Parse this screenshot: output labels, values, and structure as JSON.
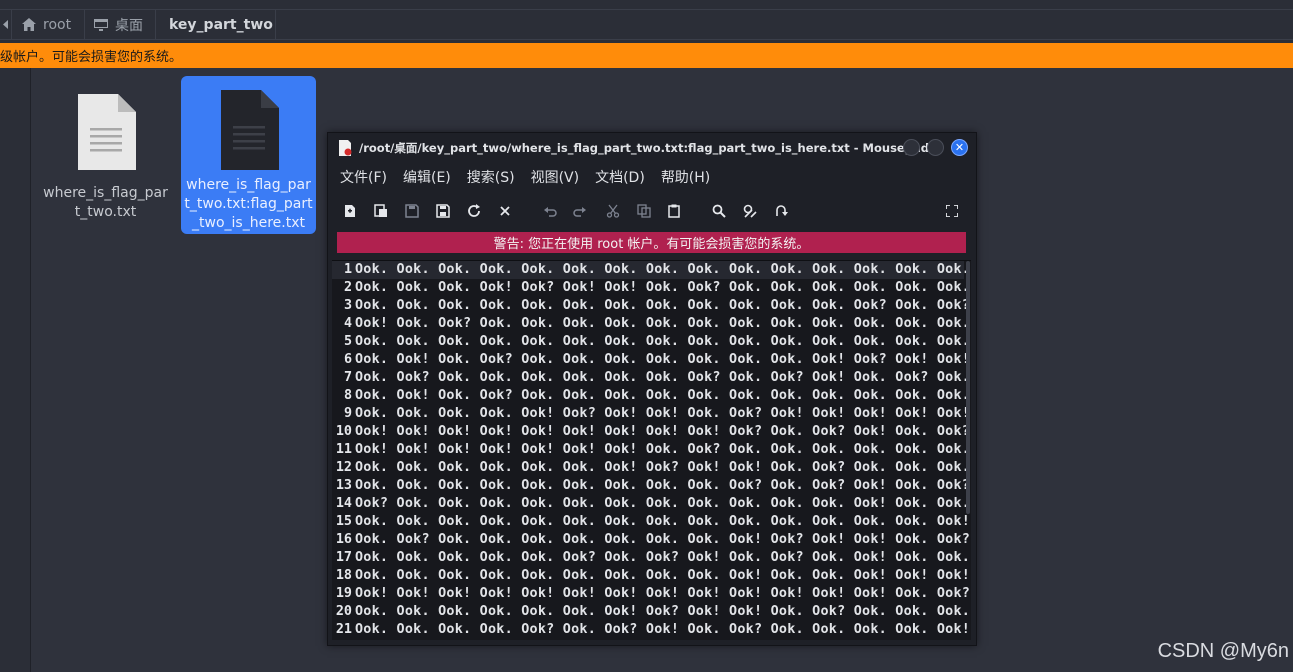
{
  "breadcrumb": {
    "items": [
      {
        "label": "root",
        "icon": "home-icon"
      },
      {
        "label": "桌面",
        "icon": "desktop-icon"
      },
      {
        "label": "key_part_two",
        "icon": ""
      }
    ]
  },
  "root_warning": "级帐户。可能会损害您的系统。",
  "files": [
    {
      "name": "where_is_flag_part_two.txt",
      "icon": "text-file-icon",
      "selected": false
    },
    {
      "name": "where_is_flag_part_two.txt:flag_part_two_is_here.txt",
      "icon": "text-file-icon",
      "selected": true
    }
  ],
  "mousepad": {
    "title": "/root/桌面/key_part_two/where_is_flag_part_two.txt:flag_part_two_is_here.txt - Mousepad",
    "menu": [
      "文件(F)",
      "编辑(E)",
      "搜索(S)",
      "视图(V)",
      "文档(D)",
      "帮助(H)"
    ],
    "warning": "警告: 您正在使用 root 帐户。有可能会损害您的系统。",
    "lines": [
      "Ook. Ook. Ook. Ook. Ook. Ook. Ook. Ook. Ook. Ook. Ook. Ook. Ook. Ook. Ook.",
      "Ook. Ook. Ook. Ook! Ook? Ook! Ook! Ook. Ook? Ook. Ook. Ook. Ook. Ook. Ook.",
      "Ook. Ook. Ook. Ook. Ook. Ook. Ook. Ook. Ook. Ook. Ook. Ook. Ook? Ook. Ook?",
      "Ook! Ook. Ook? Ook. Ook. Ook. Ook. Ook. Ook. Ook. Ook. Ook. Ook. Ook. Ook.",
      "Ook. Ook. Ook. Ook. Ook. Ook. Ook. Ook. Ook. Ook. Ook. Ook. Ook. Ook. Ook.",
      "Ook. Ook! Ook. Ook? Ook. Ook. Ook. Ook. Ook. Ook. Ook. Ook! Ook? Ook! Ook!",
      "Ook. Ook? Ook. Ook. Ook. Ook. Ook. Ook. Ook? Ook. Ook? Ook! Ook. Ook? Ook.",
      "Ook. Ook! Ook. Ook? Ook. Ook. Ook. Ook. Ook. Ook. Ook. Ook. Ook. Ook. Ook.",
      "Ook. Ook. Ook. Ook. Ook! Ook? Ook! Ook! Ook. Ook? Ook! Ook! Ook! Ook! Ook!",
      "Ook! Ook! Ook! Ook! Ook! Ook! Ook! Ook! Ook! Ook? Ook. Ook? Ook! Ook. Ook?",
      "Ook! Ook! Ook! Ook! Ook! Ook! Ook! Ook. Ook? Ook. Ook. Ook. Ook. Ook. Ook.",
      "Ook. Ook. Ook. Ook. Ook. Ook. Ook! Ook? Ook! Ook! Ook. Ook? Ook. Ook. Ook.",
      "Ook. Ook. Ook. Ook. Ook. Ook. Ook. Ook. Ook. Ook? Ook. Ook? Ook! Ook. Ook?",
      "Ook? Ook. Ook. Ook. Ook. Ook. Ook. Ook. Ook. Ook. Ook. Ook. Ook! Ook. Ook.",
      "Ook. Ook. Ook. Ook. Ook. Ook. Ook. Ook. Ook. Ook. Ook. Ook. Ook. Ook. Ook!",
      "Ook. Ook? Ook. Ook. Ook. Ook. Ook. Ook. Ook. Ook! Ook? Ook! Ook! Ook. Ook?",
      "Ook. Ook. Ook. Ook. Ook. Ook? Ook. Ook? Ook! Ook. Ook? Ook. Ook! Ook. Ook.",
      "Ook. Ook. Ook. Ook. Ook. Ook. Ook. Ook. Ook. Ook! Ook. Ook. Ook! Ook! Ook!",
      "Ook! Ook! Ook! Ook! Ook! Ook! Ook! Ook! Ook! Ook! Ook! Ook! Ook! Ook. Ook?",
      "Ook. Ook. Ook. Ook. Ook. Ook. Ook! Ook? Ook! Ook! Ook. Ook? Ook. Ook. Ook.",
      "Ook. Ook. Ook. Ook. Ook? Ook. Ook? Ook! Ook. Ook? Ook. Ook. Ook. Ook. Ook!"
    ]
  },
  "watermark": "CSDN @My6n",
  "colors": {
    "root_warning_bar": "#ff8c0a",
    "editor_warning_bar": "#b0214f",
    "selection": "#3b7cf5"
  }
}
